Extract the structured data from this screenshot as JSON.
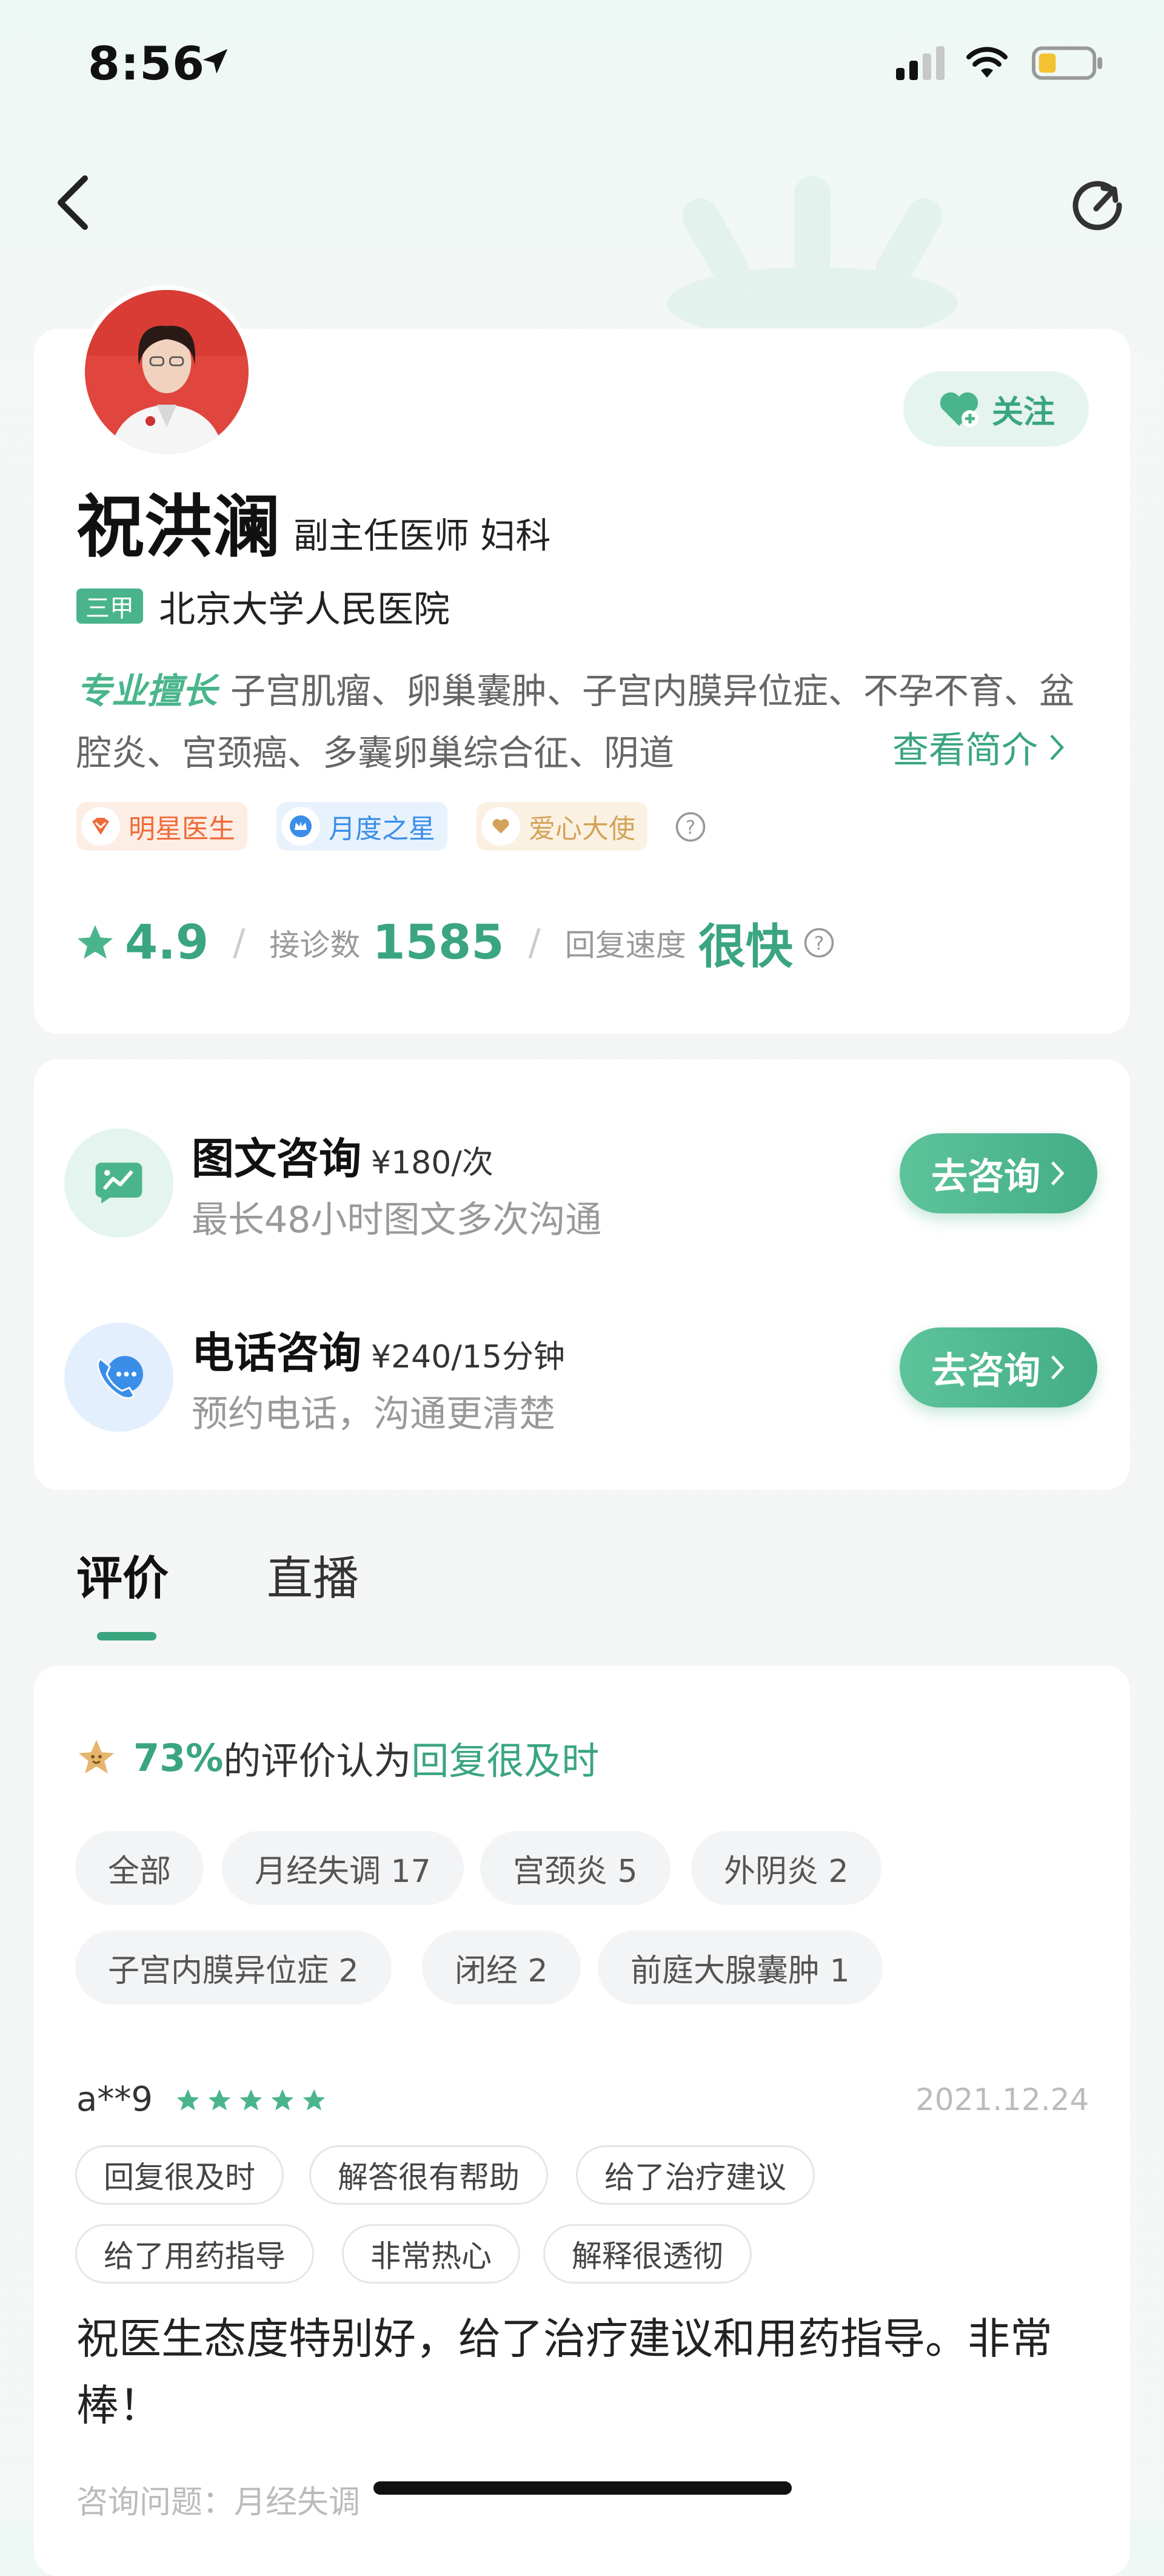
{
  "status_bar": {
    "time": "8:56"
  },
  "doctor": {
    "name": "祝洪澜",
    "title": "副主任医师 妇科",
    "hospital_tier": "三甲",
    "hospital": "北京大学人民医院",
    "follow_label": "关注",
    "expertise_label": "专业擅长",
    "expertise_text": "子宫肌瘤、卵巢囊肿、子宫内膜异位症、不孕不育、盆腔炎、宫颈癌、多囊卵巢综合征、阴道",
    "view_intro_label": "查看简介",
    "badges": [
      {
        "label": "明星医生",
        "color": "#f06a3a"
      },
      {
        "label": "月度之星",
        "color": "#3a8ee8"
      },
      {
        "label": "爱心大使",
        "color": "#d4a35a"
      }
    ],
    "rating": "4.9",
    "consult_count_label": "接诊数",
    "consult_count": "1585",
    "reply_speed_label": "回复速度",
    "reply_speed": "很快"
  },
  "consult_services": [
    {
      "title": "图文咨询",
      "price": "¥180/次",
      "desc": "最长48小时图文多次沟通",
      "button": "去咨询",
      "icon": "chat-image-icon"
    },
    {
      "title": "电话咨询",
      "price": "¥240/15分钟",
      "desc": "预约电话，沟通更清楚",
      "button": "去咨询",
      "icon": "phone-icon"
    }
  ],
  "tabs": [
    {
      "label": "评价",
      "active": true
    },
    {
      "label": "直播",
      "active": false
    }
  ],
  "review_summary": {
    "percent": "73%",
    "middle": "的评价认为",
    "highlight": "回复很及时"
  },
  "filter_chips": [
    "全部",
    "月经失调 17",
    "宫颈炎 5",
    "外阴炎 2",
    "子宫内膜异位症 2",
    "闭经 2",
    "前庭大腺囊肿 1"
  ],
  "review": {
    "user": "a**9",
    "stars": 5,
    "date": "2021.12.24",
    "tags": [
      "回复很及时",
      "解答很有帮助",
      "给了治疗建议",
      "给了用药指导",
      "非常热心",
      "解释很透彻"
    ],
    "text": "祝医生态度特别好，给了治疗建议和用药指导。非常棒！",
    "question": "咨询问题：月经失调"
  },
  "colors": {
    "accent": "#3aa57f",
    "star": "#4ab58c"
  }
}
